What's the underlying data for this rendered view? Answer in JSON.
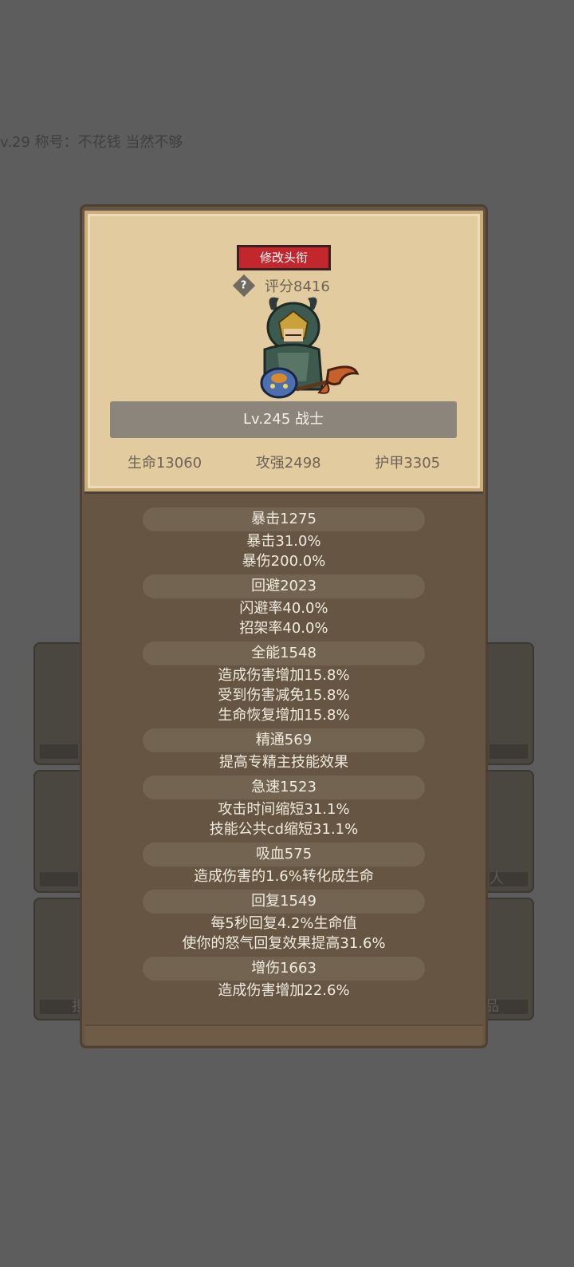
{
  "background": {
    "title_line": "v.29 称号：不花钱 当然不够",
    "side_captions": [
      "",
      "人",
      "担",
      "品"
    ]
  },
  "card": {
    "rename_button": "修改头衔",
    "help_icon": "?",
    "score": "评分8416",
    "level_class": "Lv.245 战士",
    "stats": [
      "生命13060",
      "攻强2498",
      "护甲3305"
    ]
  },
  "attributes": [
    {
      "header": "暴击1275",
      "lines": [
        "暴击31.0%",
        "暴伤200.0%"
      ]
    },
    {
      "header": "回避2023",
      "lines": [
        "闪避率40.0%",
        "招架率40.0%"
      ]
    },
    {
      "header": "全能1548",
      "lines": [
        "造成伤害增加15.8%",
        "受到伤害减免15.8%",
        "生命恢复增加15.8%"
      ]
    },
    {
      "header": "精通569",
      "lines": [
        "提高专精主技能效果"
      ]
    },
    {
      "header": "急速1523",
      "lines": [
        "攻击时间缩短31.1%",
        "技能公共cd缩短31.1%"
      ]
    },
    {
      "header": "吸血575",
      "lines": [
        "造成伤害的1.6%转化成生命"
      ]
    },
    {
      "header": "回复1549",
      "lines": [
        "每5秒回复4.2%生命值",
        "使你的怒气回复效果提高31.6%"
      ]
    },
    {
      "header": "增伤1663",
      "lines": [
        "造成伤害增加22.6%"
      ]
    }
  ],
  "colors": {
    "button_red": "#c1272d",
    "panel_brown": "#665542",
    "parchment": "#e3cba0"
  }
}
